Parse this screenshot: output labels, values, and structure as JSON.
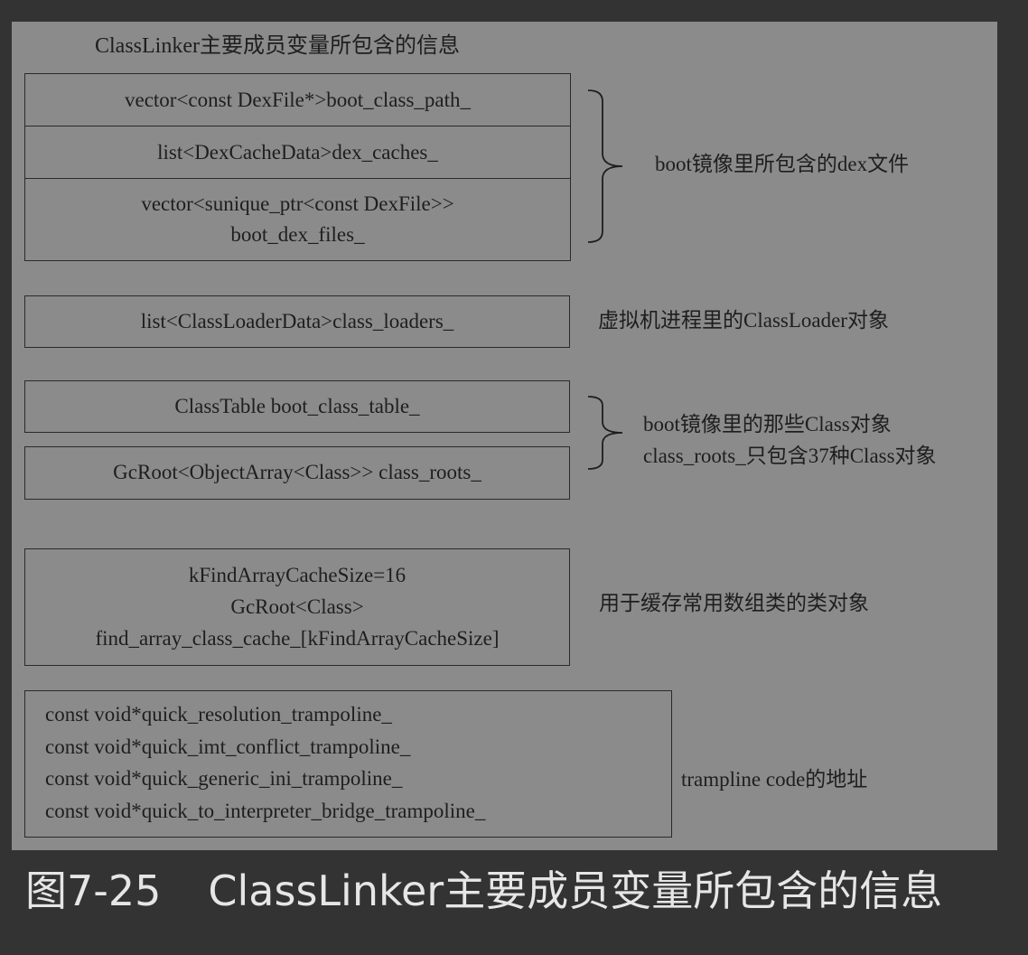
{
  "diagram": {
    "title": "ClassLinker主要成员变量所包含的信息",
    "group1": {
      "fields": [
        "vector<const DexFile*>boot_class_path_",
        "list<DexCacheData>dex_caches_"
      ],
      "field3_line1": "vector<sunique_ptr<const DexFile>>",
      "field3_line2": "boot_dex_files_",
      "note": "boot镜像里所包含的dex文件"
    },
    "group2": {
      "field": "list<ClassLoaderData>class_loaders_",
      "note": "虚拟机进程里的ClassLoader对象"
    },
    "group3": {
      "fields": [
        "ClassTable boot_class_table_",
        "GcRoot<ObjectArray<Class>> class_roots_"
      ],
      "note_line1": "boot镜像里的那些Class对象",
      "note_line2": "class_roots_只包含37种Class对象"
    },
    "group4": {
      "lines": [
        "kFindArrayCacheSize=16",
        "GcRoot<Class>",
        "find_array_class_cache_[kFindArrayCacheSize]"
      ],
      "note": "用于缓存常用数组类的类对象"
    },
    "group5": {
      "lines": [
        "const void*quick_resolution_trampoline_",
        "const void*quick_imt_conflict_trampoline_",
        "const void*quick_generic_ini_trampoline_",
        "const void*quick_to_interpreter_bridge_trampoline_"
      ],
      "note": "trampline code的地址"
    }
  },
  "caption": {
    "number": "图7-25",
    "text": "ClassLinker主要成员变量所包含的信息"
  }
}
